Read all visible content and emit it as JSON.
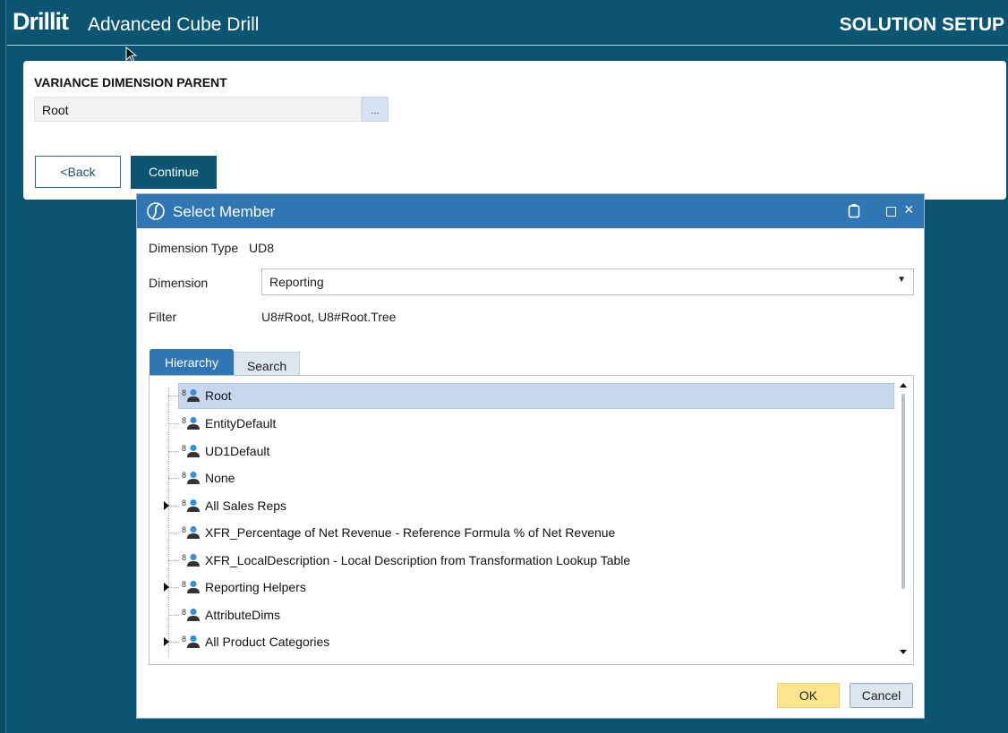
{
  "header": {
    "logo": "Drillit",
    "title": "Advanced Cube Drill",
    "section": "SOLUTION SETUP"
  },
  "setup": {
    "label": "VARIANCE DIMENSION PARENT",
    "value": "Root",
    "browse_label": "...",
    "back_label": "<Back",
    "continue_label": "Continue"
  },
  "dialog": {
    "title": "Select Member",
    "dimension_type_label": "Dimension Type",
    "dimension_type_value": "UD8",
    "dimension_label": "Dimension",
    "dimension_value": "Reporting",
    "filter_label": "Filter",
    "filter_value": "U8#Root, U8#Root.Tree",
    "tabs": [
      {
        "label": "Hierarchy",
        "active": true
      },
      {
        "label": "Search",
        "active": false
      }
    ],
    "tree": [
      {
        "label": "Root",
        "selected": true,
        "expandable": false
      },
      {
        "label": "EntityDefault",
        "selected": false,
        "expandable": false
      },
      {
        "label": "UD1Default",
        "selected": false,
        "expandable": false
      },
      {
        "label": "None",
        "selected": false,
        "expandable": false
      },
      {
        "label": "All Sales Reps",
        "selected": false,
        "expandable": true
      },
      {
        "label": "XFR_Percentage of Net Revenue - Reference Formula % of Net Revenue",
        "selected": false,
        "expandable": false
      },
      {
        "label": "XFR_LocalDescription - Local Description from Transformation Lookup Table",
        "selected": false,
        "expandable": false
      },
      {
        "label": "Reporting Helpers",
        "selected": false,
        "expandable": true
      },
      {
        "label": "AttributeDims",
        "selected": false,
        "expandable": false
      },
      {
        "label": "All Product Categories",
        "selected": false,
        "expandable": true
      }
    ],
    "member_icon_text": "8",
    "ok_label": "OK",
    "cancel_label": "Cancel"
  },
  "colors": {
    "background": "#0b5572",
    "dialog_title": "#2f76b3",
    "selection": "#c7d7ee",
    "ok_button": "#fde58f"
  }
}
